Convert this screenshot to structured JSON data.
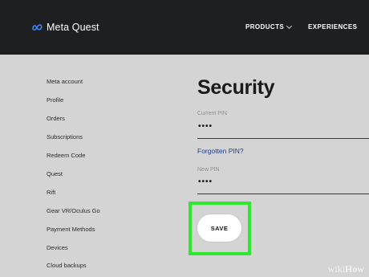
{
  "header": {
    "brand": "Meta Quest",
    "nav": [
      {
        "label": "PRODUCTS"
      },
      {
        "label": "EXPERIENCES"
      }
    ]
  },
  "sidebar": {
    "items": [
      {
        "label": "Meta account"
      },
      {
        "label": "Profile"
      },
      {
        "label": "Orders"
      },
      {
        "label": "Subscriptions"
      },
      {
        "label": "Redeem Code"
      },
      {
        "label": "Quest"
      },
      {
        "label": "Rift"
      },
      {
        "label": "Gear VR/Oculus Go"
      },
      {
        "label": "Payment Methods"
      },
      {
        "label": "Devices"
      },
      {
        "label": "Cloud backups"
      }
    ]
  },
  "main": {
    "title": "Security",
    "current_pin": {
      "label": "Current PIN",
      "value": "••••"
    },
    "forgot_link": "Forgotten PIN?",
    "new_pin": {
      "label": "New PIN",
      "value": "••••"
    },
    "save_label": "SAVE"
  },
  "watermark": {
    "part1": "wiki",
    "part2": "How"
  },
  "colors": {
    "header_bg": "#1e1f21",
    "page_bg": "#d4d4d4",
    "highlight": "#2ee82e",
    "link": "#1c3d8f"
  },
  "icons": {
    "logo": "meta-infinity-icon",
    "nav_dropdown": "chevron-down-icon"
  }
}
